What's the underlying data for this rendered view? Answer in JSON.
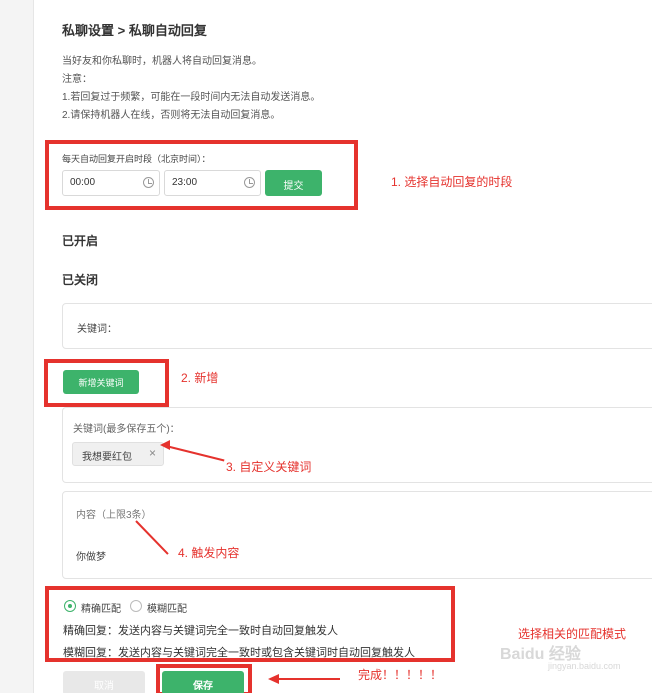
{
  "page": {
    "title": "私聊设置 > 私聊自动回复",
    "notes": [
      "当好友和你私聊时，机器人将自动回复消息。",
      "注意：",
      "1.若回复过于频繁，可能在一段时间内无法自动发送消息。",
      "2.请保持机器人在线，否则将无法自动回复消息。"
    ]
  },
  "schedule": {
    "label": "每天自动回复开启时段（北京时间）：",
    "start_time": "00:00",
    "end_time": "23:00",
    "submit_label": "提交"
  },
  "status": {
    "enabled": "已开启",
    "disabled": "已关闭"
  },
  "keyword_panel": {
    "label": "关键词：",
    "add_button": "新增关键词",
    "editor_label": "关键词(最多保存五个)：",
    "tag": "我想要红包",
    "tag_close": "×"
  },
  "content_panel": {
    "label": "内容（上限3条）",
    "value": "你做梦"
  },
  "match_mode": {
    "options": [
      "精确匹配",
      "模糊匹配"
    ],
    "selected": "精确匹配",
    "exact_desc": "精确回复：发送内容与关键词完全一致时自动回复触发人",
    "fuzzy_desc": "模糊回复：发送内容与关键词完全一致时或包含关键词时自动回复触发人"
  },
  "footer": {
    "cancel_label": "取消",
    "save_label": "保存"
  },
  "annotations": {
    "step1": "1. 选择自动回复的时段",
    "step2": "2. 新增",
    "step3": "3. 自定义关键词",
    "step4": "4. 触发内容",
    "step5": "选择相关的匹配模式",
    "done": "完成！！！！！"
  },
  "watermark": "Baidu 经验",
  "watermark_url": "jingyan.baidu.com",
  "colors": {
    "accent_green": "#3db36b",
    "annotation_red": "#e5322d"
  }
}
